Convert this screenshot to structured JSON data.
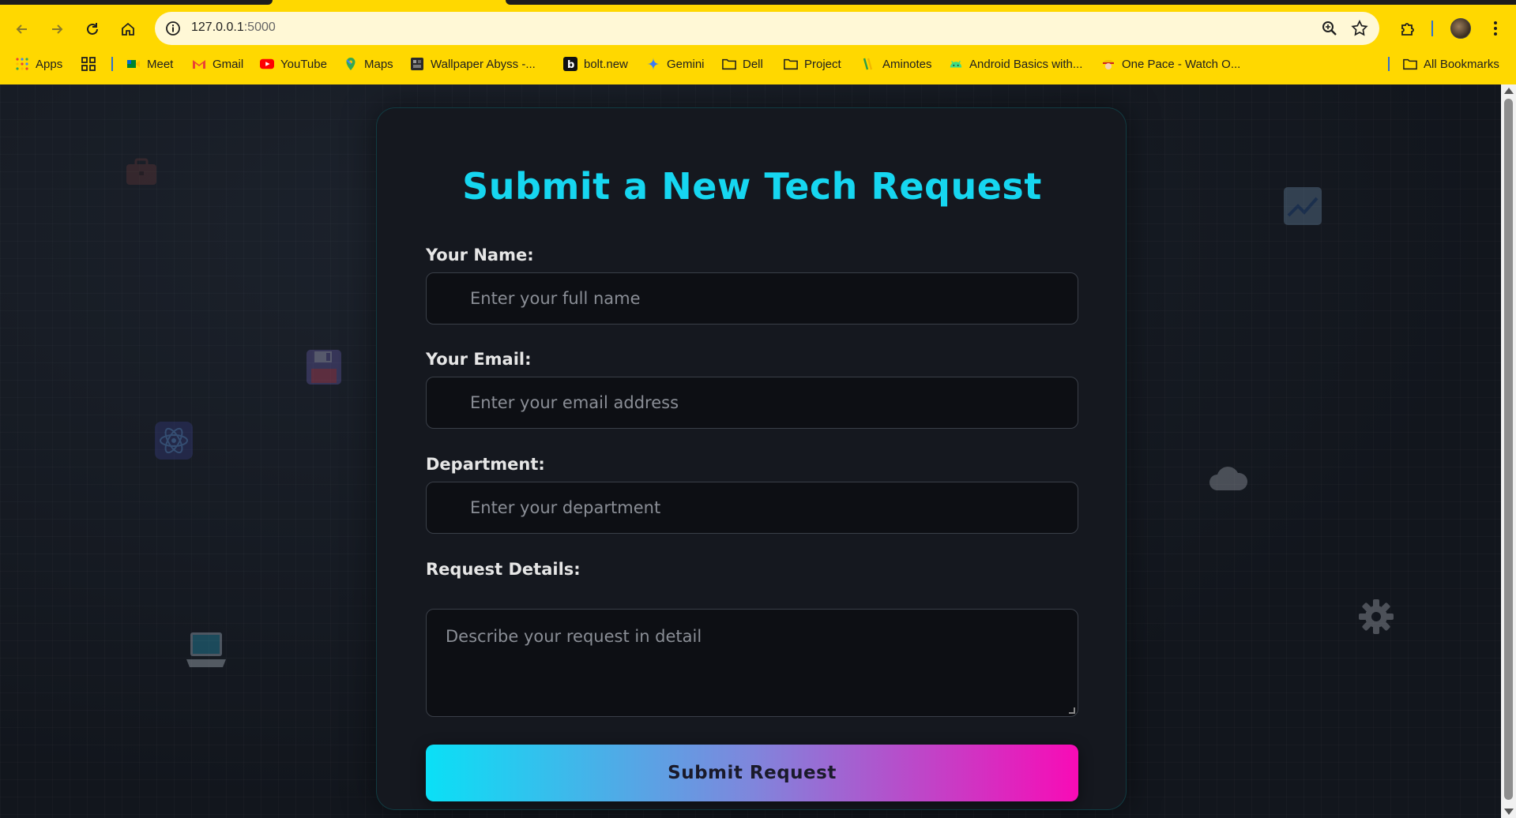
{
  "browser": {
    "url_host": "127.0.0.1",
    "url_port": ":5000",
    "bookmarks": [
      {
        "label": "Apps",
        "icon": "apps-grid-icon"
      },
      {
        "label": "",
        "icon": "tab-groups-icon"
      },
      {
        "label": "Meet",
        "icon": "meet-icon"
      },
      {
        "label": "Gmail",
        "icon": "gmail-icon"
      },
      {
        "label": "YouTube",
        "icon": "youtube-icon"
      },
      {
        "label": "Maps",
        "icon": "maps-icon"
      },
      {
        "label": "Wallpaper Abyss -...",
        "icon": "wallpaper-abyss-icon"
      },
      {
        "label": "bolt.new",
        "icon": "bolt-icon"
      },
      {
        "label": "Gemini",
        "icon": "gemini-icon"
      },
      {
        "label": "Dell",
        "icon": "folder-icon"
      },
      {
        "label": "Project",
        "icon": "folder-icon"
      },
      {
        "label": "Aminotes",
        "icon": "aminotes-icon"
      },
      {
        "label": "Android Basics with...",
        "icon": "android-icon"
      },
      {
        "label": "One Pace - Watch O...",
        "icon": "one-pace-icon"
      }
    ],
    "all_bookmarks": "All Bookmarks"
  },
  "form": {
    "title": "Submit a New Tech Request",
    "name_label": "Your Name:",
    "name_placeholder": "Enter your full name",
    "email_label": "Your Email:",
    "email_placeholder": "Enter your email address",
    "department_label": "Department:",
    "department_placeholder": "Enter your department",
    "details_label": "Request Details:",
    "details_placeholder": "Describe your request in detail",
    "submit_label": "Submit Request"
  },
  "colors": {
    "accent_cyan": "#16d6f0",
    "gradient_start": "#0ae0f6",
    "gradient_end": "#f80bb6",
    "chrome_yellow": "#ffd800"
  }
}
